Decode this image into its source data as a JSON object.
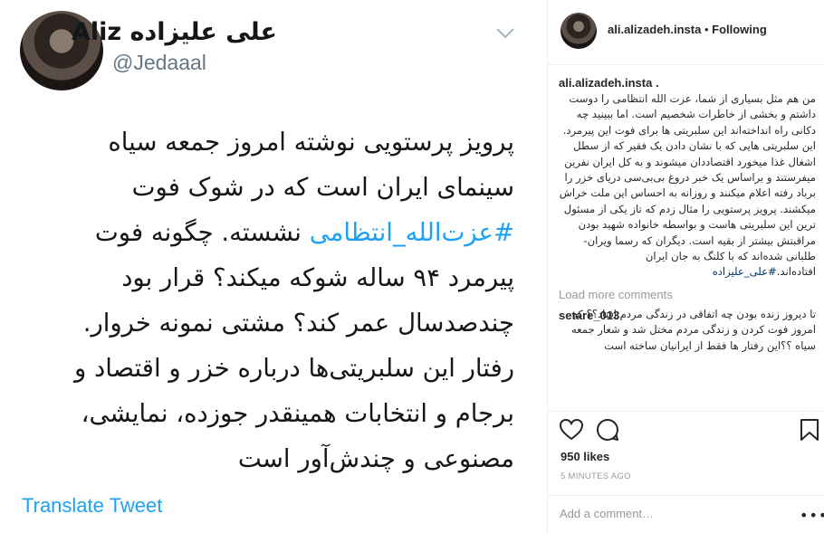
{
  "tweet": {
    "display_name": "علی علیزاده Aliz",
    "handle": "@Jedaaal",
    "lines": [
      "پرویز پرستویی نوشته امروز جمعه سیاه",
      "سینمای ایران است که در شوک فوت",
      "نشسته. چگونه فوت",
      "پیرمرد ۹۴ ساله شوکه میکند؟ قرار بود",
      "چندصدسال عمر کند؟ مشتی نمونه خروار.",
      "رفتار این سلبریتی‌ها درباره خزر و اقتصاد و",
      "برجام و انتخابات همینقدر جوزده، نمایشی،",
      "مصنوعی و چندش‌آور است"
    ],
    "hashtag": "#عزت‌الله_انتظامی",
    "translate_label": "Translate Tweet"
  },
  "post": {
    "username": "ali.alizadeh.insta",
    "separator": "•",
    "follow_status": "Following",
    "caption_user": "ali.alizadeh.insta",
    "caption_user_suffix": " .",
    "caption": "من هم مثل بسیاری از شما، عزت الله انتظامی را دوست داشتم و بخشی از خاطرات شخصیم است. اما ببینید چه دکانی راه انداخته‌اند این سلبریتی ها برای فوت این پیرمرد. این سلبریتی هایی که با نشان دادن یک فقیر که از سطل اشغال غذا میخورد اقتصاددان میشوند و به کل ایران نفرین میفرستند و براساس یک خبر دروغ بی‌بی‌سی دریای خزر را برباد رفته اعلام میکنند و روزانه به احساس این ملت خراش میکشند. پرویز پرستویی را مثال زدم که تاز یکی از مسئول ترین این سلبریتی هاست و بواسطه خانواده شهید بودن مراقبتش بیشتر از بقیه است. دیگران که رسما ویران-طلبانی شده‌اند که با کلنگ به جان ایران افتاده‌اند.",
    "caption_tag": "#علی_علیزاده",
    "load_more": "Load more comments",
    "comment_user": "setare_013",
    "comment_text": "تا دیروز زنده بودن چه اتفاقی در زندگی مردم افتاد؟؟ که امروز فوت کردن و زندگی مردم مختل شد و شعار جمعه سیاه ؟؟این رفتار ها فقط از ایرانیان ساخته است",
    "likes": "950 likes",
    "time": "5 MINUTES AGO",
    "add_comment_placeholder": "Add a comment…",
    "more_glyph": "•••"
  },
  "colors": {
    "twitter_blue": "#1da1f2",
    "ig_text": "#262626",
    "ig_muted": "#999999",
    "ig_link": "#003569"
  }
}
